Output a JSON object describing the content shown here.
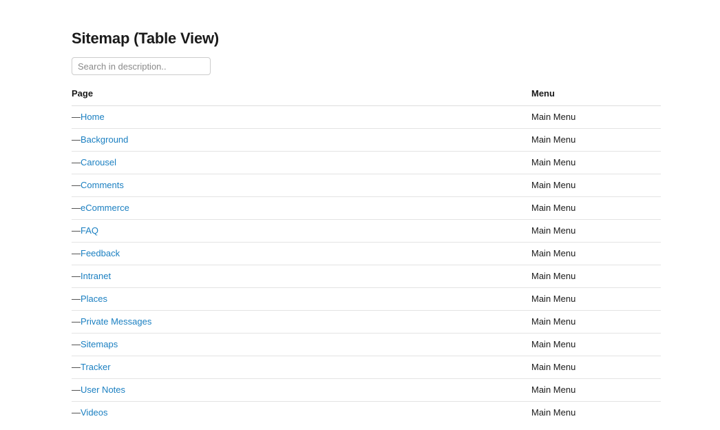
{
  "page": {
    "title": "Sitemap (Table View)"
  },
  "search": {
    "placeholder": "Search in description..",
    "value": ""
  },
  "table": {
    "headers": {
      "page": "Page",
      "menu": "Menu"
    },
    "row_prefix": "—",
    "rows": [
      {
        "page": "Home",
        "menu": "Main Menu"
      },
      {
        "page": "Background",
        "menu": "Main Menu"
      },
      {
        "page": "Carousel",
        "menu": "Main Menu"
      },
      {
        "page": "Comments",
        "menu": "Main Menu"
      },
      {
        "page": "eCommerce",
        "menu": "Main Menu"
      },
      {
        "page": "FAQ",
        "menu": "Main Menu"
      },
      {
        "page": "Feedback",
        "menu": "Main Menu"
      },
      {
        "page": "Intranet",
        "menu": "Main Menu"
      },
      {
        "page": "Places",
        "menu": "Main Menu"
      },
      {
        "page": "Private Messages",
        "menu": "Main Menu"
      },
      {
        "page": "Sitemaps",
        "menu": "Main Menu"
      },
      {
        "page": "Tracker",
        "menu": "Main Menu"
      },
      {
        "page": "User Notes",
        "menu": "Main Menu"
      },
      {
        "page": "Videos",
        "menu": "Main Menu"
      }
    ]
  },
  "colors": {
    "link": "#1a7fc1",
    "text": "#1a1a1a",
    "border": "#e3e3e3",
    "header_border": "#dddddd",
    "placeholder": "#8a8a8a"
  }
}
